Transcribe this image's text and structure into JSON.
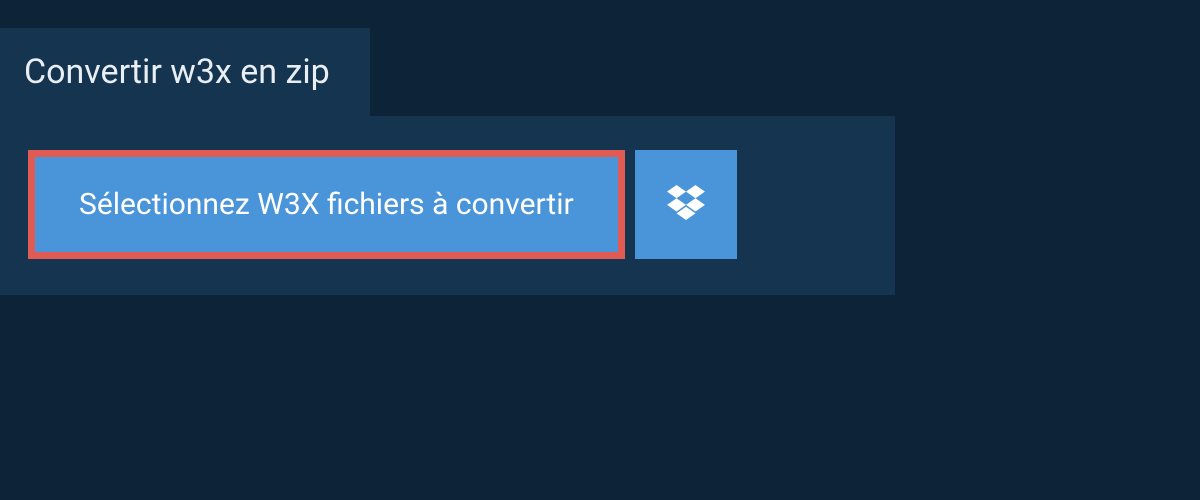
{
  "header": {
    "title": "Convertir w3x en zip"
  },
  "actions": {
    "select_label": "Sélectionnez W3X fichiers à convertir",
    "dropbox_icon": "dropbox"
  },
  "colors": {
    "bg": "#0d2438",
    "panel": "#14344f",
    "button": "#4a94d9",
    "highlight_border": "#e05b53",
    "text": "#ffffff"
  }
}
